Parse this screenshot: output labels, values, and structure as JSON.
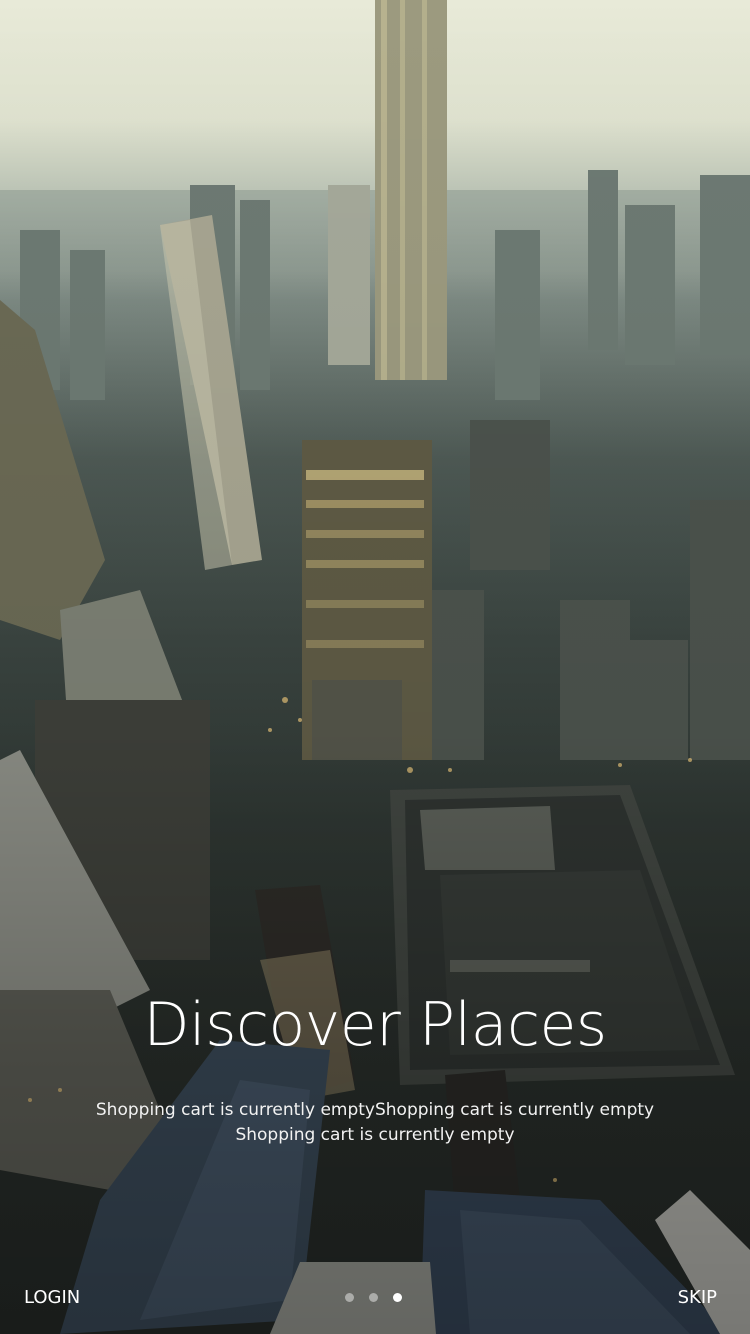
{
  "onboarding": {
    "title": "Discover Places",
    "subtitle_line1": "Shopping cart is currently emptyShopping cart is currently empty",
    "subtitle_line2": "Shopping cart is currently empty",
    "pager": {
      "count": 3,
      "active_index": 2
    }
  },
  "footer": {
    "login_label": "LOGIN",
    "skip_label": "SKIP"
  },
  "colors": {
    "text": "#ffffff",
    "dot_inactive": "rgba(255,255,255,0.45)",
    "dot_active": "#ffffff"
  }
}
